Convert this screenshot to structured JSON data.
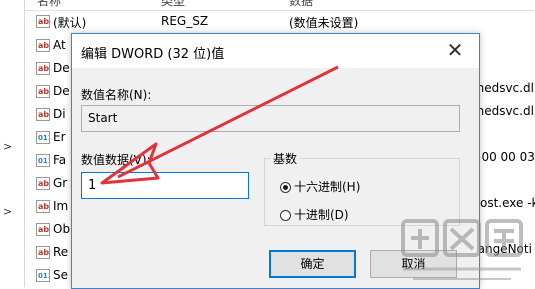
{
  "header": {
    "col_name": "名称",
    "col_type": "类型",
    "col_data": "数据"
  },
  "left_marks": [
    ">",
    ">"
  ],
  "registry_rows": [
    {
      "icon": "ab",
      "name": "(默认)",
      "type": "REG_SZ",
      "value": "(数值未设置)"
    },
    {
      "icon": "ab",
      "name": "At"
    },
    {
      "icon": "ab",
      "name": "De"
    },
    {
      "icon": "ab",
      "name": "De"
    },
    {
      "icon": "ab",
      "name": "Di"
    },
    {
      "icon": "bin",
      "name": "Er"
    },
    {
      "icon": "bin",
      "name": "Fa"
    },
    {
      "icon": "ab",
      "name": "Gr"
    },
    {
      "icon": "ab",
      "name": "Im"
    },
    {
      "icon": "ab",
      "name": "Ob"
    },
    {
      "icon": "ab",
      "name": "Re"
    },
    {
      "icon": "bin",
      "name": "Se"
    }
  ],
  "right_values": {
    "v1": "chedsvc.dl",
    "v2": "chedsvc.dl",
    "v3": "0 00 00 03",
    "v4": "ost.exe -k",
    "v5": "hangeNoti"
  },
  "dialog": {
    "title": "编辑 DWORD (32 位)值",
    "close": "✕",
    "value_name_label": "数值名称(N):",
    "value_name": "Start",
    "value_data_label": "数值数据(V):",
    "value_data": "1",
    "base_label": "基数",
    "hex_label": "十六进制(H)",
    "dec_label": "十进制(D)",
    "selected_base": "hex",
    "ok": "确定",
    "cancel": "取消"
  },
  "colors": {
    "accent": "#0078d7",
    "arrow": "#e0333c",
    "dialog_bg": "#f0f0f0"
  }
}
